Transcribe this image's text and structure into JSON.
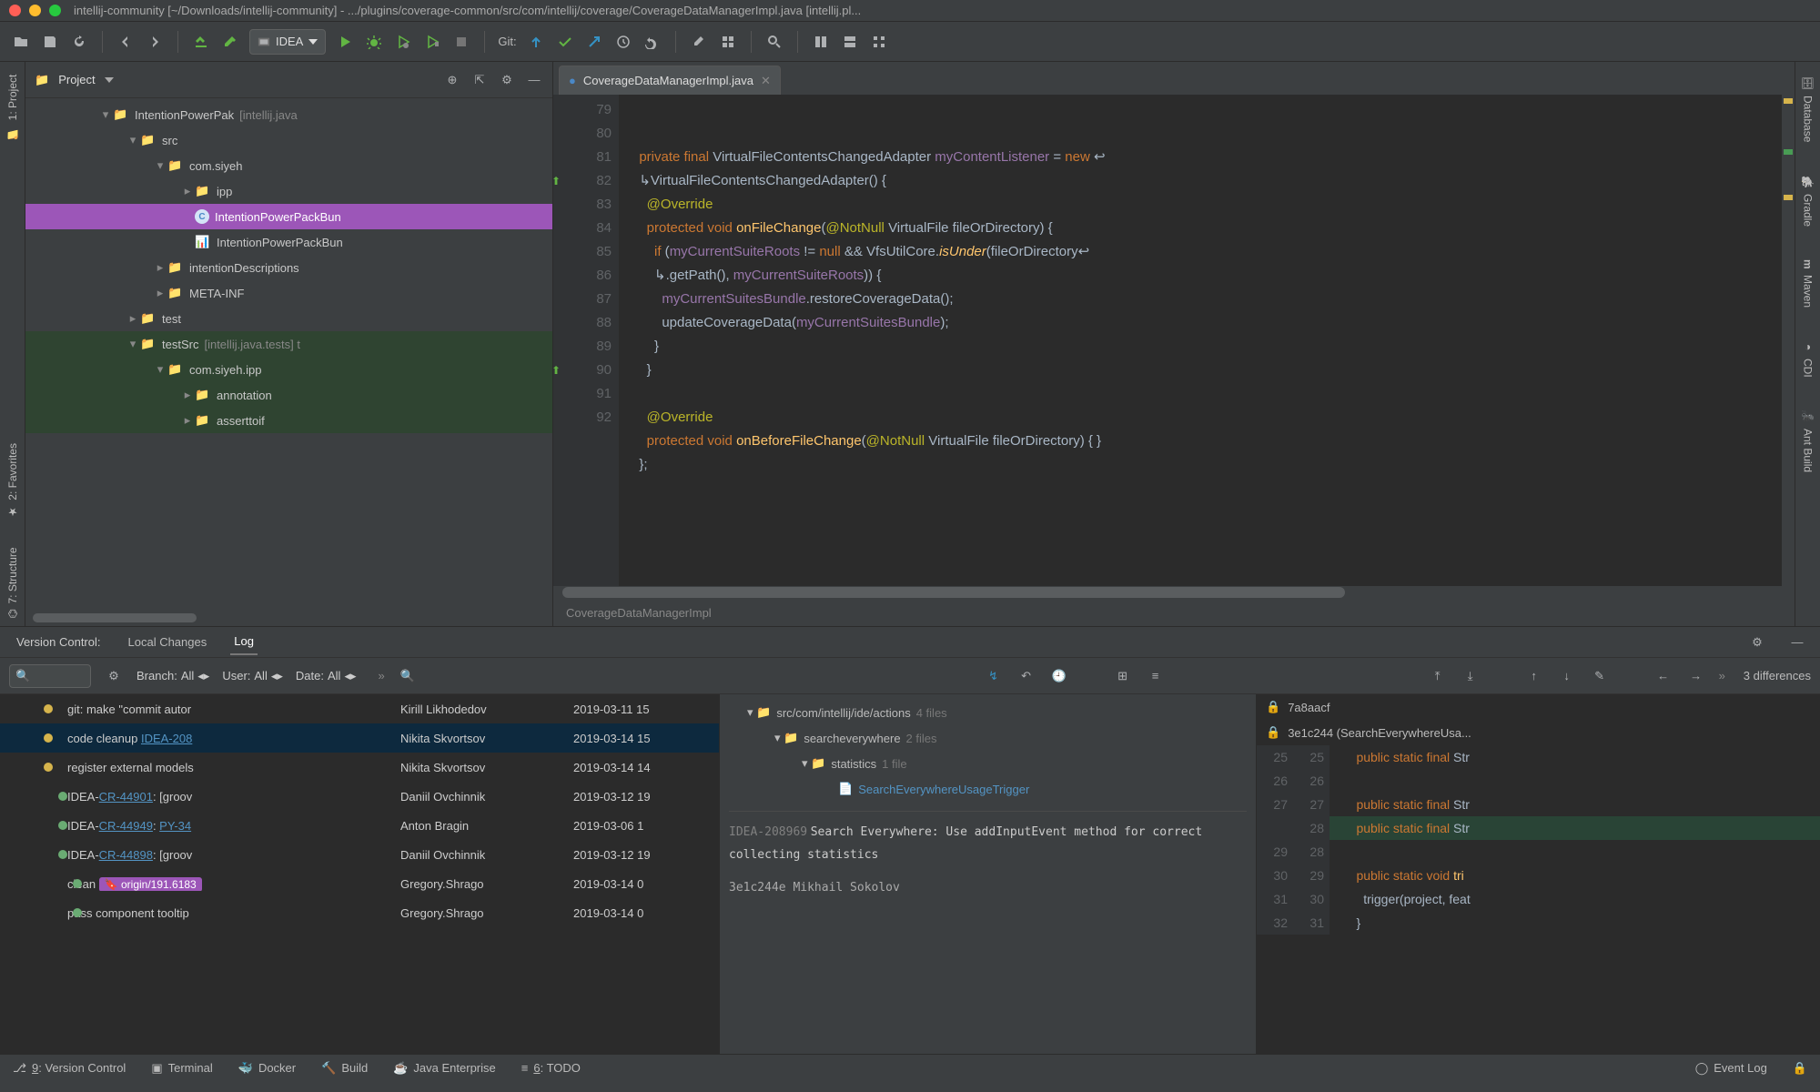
{
  "title": "intellij-community [~/Downloads/intellij-community] - .../plugins/coverage-common/src/com/intellij/coverage/CoverageDataManagerImpl.java [intellij.pl...",
  "toolbar": {
    "run_config": "IDEA",
    "git_label": "Git:"
  },
  "right_tabs": {
    "database": "Database",
    "gradle": "Gradle",
    "maven": "Maven",
    "cdi": "CDI",
    "ant": "Ant Build"
  },
  "left_tabs": {
    "project": "1: Project",
    "favorites": "2: Favorites",
    "structure": "7: Structure"
  },
  "project": {
    "title": "Project",
    "tree": [
      {
        "ind": 80,
        "exp": "▾",
        "icon": "📁",
        "label": "IntentionPowerPak",
        "scope": "[intellij.java"
      },
      {
        "ind": 110,
        "exp": "▾",
        "icon": "📁",
        "label": "src",
        "scope": ""
      },
      {
        "ind": 140,
        "exp": "▾",
        "icon": "📁",
        "label": "com.siyeh",
        "scope": ""
      },
      {
        "ind": 170,
        "exp": "▸",
        "icon": "📁",
        "label": "ipp",
        "scope": ""
      },
      {
        "ind": 170,
        "exp": "",
        "icon": "C",
        "label": "IntentionPowerPackBun",
        "scope": "",
        "sel": true,
        "class": true
      },
      {
        "ind": 170,
        "exp": "",
        "icon": "📊",
        "label": "IntentionPowerPackBun",
        "scope": ""
      },
      {
        "ind": 140,
        "exp": "▸",
        "icon": "📁",
        "label": "intentionDescriptions",
        "scope": ""
      },
      {
        "ind": 140,
        "exp": "▸",
        "icon": "📁",
        "label": "META-INF",
        "scope": ""
      },
      {
        "ind": 110,
        "exp": "▸",
        "icon": "📁",
        "label": "test",
        "scope": ""
      },
      {
        "ind": 110,
        "exp": "▾",
        "icon": "📁",
        "label": "testSrc",
        "scope": "[intellij.java.tests]  t",
        "hl": true
      },
      {
        "ind": 140,
        "exp": "▾",
        "icon": "📁",
        "label": "com.siyeh.ipp",
        "scope": "",
        "hl": true
      },
      {
        "ind": 170,
        "exp": "▸",
        "icon": "📁",
        "label": "annotation",
        "scope": "",
        "hl": true
      },
      {
        "ind": 170,
        "exp": "▸",
        "icon": "📁",
        "label": "asserttoif",
        "scope": "",
        "hl": true
      }
    ]
  },
  "editor": {
    "tab_name": "CoverageDataManagerImpl.java",
    "breadcrumb": "CoverageDataManagerImpl",
    "lines": [
      {
        "n": "",
        "html": ""
      },
      {
        "n": "79",
        "html": ""
      },
      {
        "n": "80",
        "html": "  <span class='kw'>private final</span> VirtualFileContentsChangedAdapter <span class='par'>myContentListener</span> = <span class='kw'>new</span> ↩"
      },
      {
        "n": "",
        "html": "  ↳VirtualFileContentsChangedAdapter() {"
      },
      {
        "n": "81",
        "html": "    <span class='ann'>@Override</span>"
      },
      {
        "n": "82",
        "html": "    <span class='kw'>protected void</span> <span class='mtd'>onFileChange</span>(<span class='ann'>@NotNull</span> VirtualFile fileOrDirectory) {",
        "mark": "↑"
      },
      {
        "n": "83",
        "html": "      <span class='kw'>if</span> (<span class='par'>myCurrentSuiteRoots</span> != <span class='kw'>null</span> && VfsUtilCore.<span class='mtd'><i>isUnder</i></span>(fileOrDirectory↩"
      },
      {
        "n": "",
        "html": "      ↳.getPath(), <span class='par'>myCurrentSuiteRoots</span>)) {"
      },
      {
        "n": "84",
        "html": "        <span class='par'>myCurrentSuitesBundle</span>.restoreCoverageData();"
      },
      {
        "n": "85",
        "html": "        updateCoverageData(<span class='par'>myCurrentSuitesBundle</span>);"
      },
      {
        "n": "86",
        "html": "      }"
      },
      {
        "n": "87",
        "html": "    }"
      },
      {
        "n": "88",
        "html": ""
      },
      {
        "n": "89",
        "html": "    <span class='ann'>@Override</span>"
      },
      {
        "n": "90",
        "html": "    <span class='kw'>protected void</span> <span class='mtd'>onBeforeFileChange</span>(<span class='ann'>@NotNull</span> VirtualFile fileOrDirectory) { }",
        "mark": "↑"
      },
      {
        "n": "91",
        "html": "  };"
      },
      {
        "n": "92",
        "html": ""
      }
    ]
  },
  "vcs": {
    "title": "Version Control:",
    "tab_local": "Local Changes",
    "tab_log": "Log",
    "filters": {
      "branch": "Branch:",
      "branch_v": "All",
      "user": "User:",
      "user_v": "All",
      "date": "Date:",
      "date_v": "All"
    },
    "diff_count": "3 differences",
    "commits": [
      {
        "msg": "git: make \"commit autor",
        "auth": "Kirill Likhodedov",
        "date": "2019-03-11 15",
        "dot": "#d6b44c",
        "x": 36
      },
      {
        "msg": "code cleanup <a class='link'>IDEA-208</a>",
        "auth": "Nikita Skvortsov",
        "date": "2019-03-14 15",
        "dot": "#d6b44c",
        "x": 36,
        "sel": true
      },
      {
        "msg": "register external models",
        "auth": "Nikita Skvortsov",
        "date": "2019-03-14 14",
        "dot": "#d6b44c",
        "x": 36
      },
      {
        "msg": "IDEA-<a class='link'>CR-44901</a>: [groov",
        "auth": "Daniil Ovchinnik",
        "date": "2019-03-12 19",
        "dot": "#6aab73",
        "x": 52
      },
      {
        "msg": "IDEA-<a class='link'>CR-44949</a>: <a class='link'>PY-34</a>",
        "auth": "Anton Bragin",
        "date": "2019-03-06 1",
        "dot": "#6aab73",
        "x": 52
      },
      {
        "msg": "IDEA-<a class='link'>CR-44898</a>: [groov",
        "auth": "Daniil Ovchinnik",
        "date": "2019-03-12 19",
        "dot": "#6aab73",
        "x": 52
      },
      {
        "msg": "clean  <span class='tag'>🔖 origin/191.6183</span>",
        "auth": "Gregory.Shrago",
        "date": "2019-03-14 0",
        "dot": "#6aab73",
        "x": 68
      },
      {
        "msg": "pass component tooltip",
        "auth": "Gregory.Shrago",
        "date": "2019-03-14 0",
        "dot": "#6aab73",
        "x": 68
      }
    ],
    "files": {
      "root": {
        "label": "src/com/intellij/ide/actions",
        "count": "4 files"
      },
      "l2": {
        "label": "searcheverywhere",
        "count": "2 files"
      },
      "l3": {
        "label": "statistics",
        "count": "1 file"
      },
      "leaf": "SearchEverywhereUsageTrigger",
      "issue": "IDEA-208969",
      "title": "Search Everywhere: Use addInputEvent method for correct collecting statistics",
      "footer": "3e1c244e Mikhail Sokolov"
    },
    "diff": {
      "hash1": "7a8aacf",
      "hash2": "3e1c244 (SearchEverywhereUsa...",
      "lines": [
        {
          "a": "25",
          "b": "25",
          "t": "     <span class='kw'>public static final</span> Str"
        },
        {
          "a": "26",
          "b": "26",
          "t": ""
        },
        {
          "a": "27",
          "b": "27",
          "t": "     <span class='kw'>public static final</span> Str"
        },
        {
          "a": "",
          "b": "28",
          "t": "     <span class='kw'>public static final</span> Str",
          "cls": "add"
        },
        {
          "a": "29",
          "b": "28",
          "t": ""
        },
        {
          "a": "30",
          "b": "29",
          "t": "     <span class='kw'>public static void</span> <span class='mtd'>tri</span>"
        },
        {
          "a": "31",
          "b": "30",
          "t": "       trigger(project, feat"
        },
        {
          "a": "32",
          "b": "31",
          "t": "     }"
        },
        {
          "a": "",
          "b": "",
          "t": ""
        }
      ]
    }
  },
  "status": {
    "vc": "9: Version Control",
    "terminal": "Terminal",
    "docker": "Docker",
    "build": "Build",
    "jee": "Java Enterprise",
    "todo": "6: TODO",
    "event": "Event Log"
  }
}
